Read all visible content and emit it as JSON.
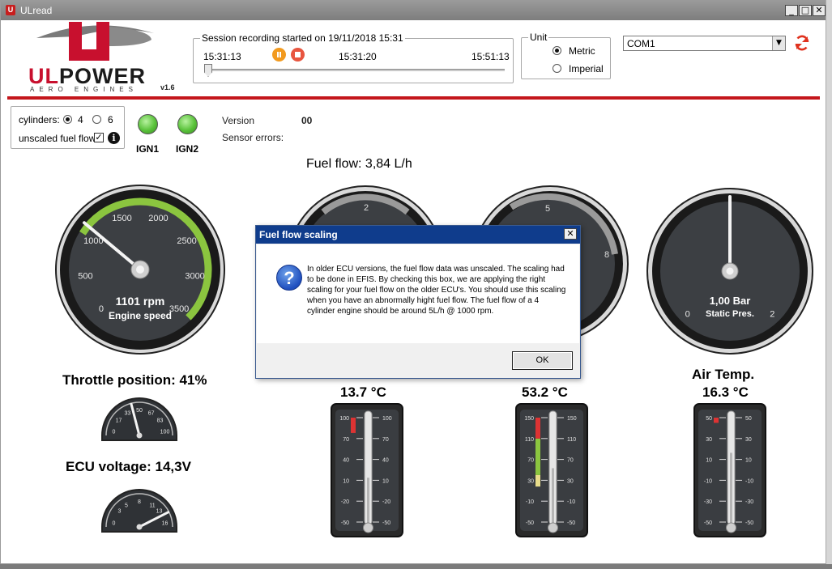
{
  "window": {
    "title": "ULread",
    "minimize": "_",
    "maximize": "□",
    "close": "✕"
  },
  "logo": {
    "word_a": "UL",
    "word_b": "POWER",
    "tagline": "AERO ENGINES",
    "version": "v1.6"
  },
  "session": {
    "heading": "Session recording started on 19/11/2018 15:31",
    "time_start": "15:31:13",
    "time_current": "15:31:20",
    "time_end": "15:51:13",
    "position_fraction": 0.0
  },
  "unit": {
    "heading": "Unit",
    "options": [
      "Metric",
      "Imperial"
    ],
    "selected": "Metric"
  },
  "port": {
    "value": "COM1"
  },
  "options_panel": {
    "cylinders_label": "cylinders:",
    "cylinder_options": [
      "4",
      "6"
    ],
    "cylinders_selected": "4",
    "fuel_flow_label": "unscaled fuel flow",
    "fuel_flow_checked": true,
    "info_glyph": "i"
  },
  "ignition": [
    {
      "label": "IGN1",
      "color": "#59c23a"
    },
    {
      "label": "IGN2",
      "color": "#59c23a"
    }
  ],
  "version_label": "Version",
  "version_value": "00",
  "sensor_errors_label": "Sensor errors:",
  "fuel_flow_text": "Fuel flow: 3,84 L/h",
  "rpm_gauge": {
    "value_text": "1101 rpm",
    "title": "Engine speed",
    "ticks": [
      "0",
      "500",
      "1000",
      "1500",
      "2000",
      "2500",
      "3000",
      "3500"
    ],
    "value": 1101,
    "min": 0,
    "max": 3500
  },
  "gauge2_ticks": [
    "2"
  ],
  "gauge3_ticks": [
    "5",
    "8"
  ],
  "static_gauge": {
    "value_text": "1,00 Bar",
    "title": "Static Pres.",
    "ticks": [
      "0",
      "2"
    ],
    "value": 1.0,
    "min": 0,
    "max": 2
  },
  "throttle": {
    "title": "Throttle position: 41%",
    "ticks": [
      "0",
      "17",
      "33",
      "50",
      "67",
      "83",
      "100"
    ],
    "value": 41
  },
  "ecu_voltage": {
    "title": "ECU voltage: 14,3V",
    "ticks": [
      "0",
      "3",
      "5",
      "8",
      "11",
      "13",
      "16"
    ],
    "value": 14.3
  },
  "thermo1": {
    "value_text": "13.7 °C",
    "ticks": [
      "100",
      "70",
      "40",
      "10",
      "-20",
      "-50"
    ],
    "min": -50,
    "max": 100,
    "value": 13.7
  },
  "thermo2": {
    "value_text": "53.2 °C",
    "ticks": [
      "150",
      "110",
      "70",
      "30",
      "-10",
      "-50"
    ],
    "min": -50,
    "max": 150,
    "value": 53.2
  },
  "thermo3": {
    "title": "Air Temp.",
    "value_text": "16.3 °C",
    "ticks": [
      "50",
      "30",
      "10",
      "-10",
      "-30",
      "-50"
    ],
    "min": -50,
    "max": 50,
    "value": 16.3
  },
  "dialog": {
    "title": "Fuel flow scaling",
    "close": "✕",
    "message": "In older ECU versions, the fuel flow data was unscaled. The scaling had to be done in EFIS. By checking this box, we are applying the right scaling for your fuel flow on the older ECU's. You should use this scaling when you have an abnormally hight fuel flow. The fuel flow of a 4 cylinder engine should be around 5L/h @ 1000 rpm.",
    "ok": "OK",
    "icon": "?"
  },
  "colors": {
    "brand_red": "#c4161c",
    "gauge_green": "#8bc53f",
    "dialog_title": "#0f3c8c"
  }
}
